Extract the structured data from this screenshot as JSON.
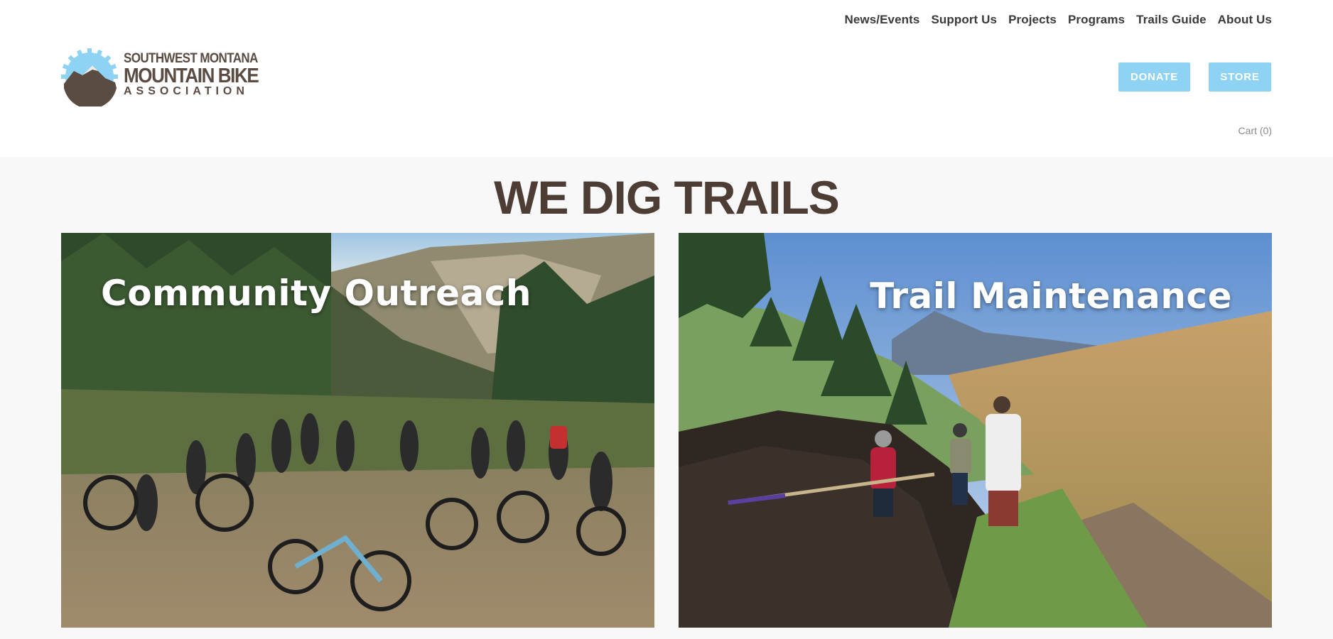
{
  "nav": {
    "items": [
      {
        "label": "News/Events"
      },
      {
        "label": "Support Us"
      },
      {
        "label": "Projects"
      },
      {
        "label": "Programs"
      },
      {
        "label": "Trails Guide"
      },
      {
        "label": "About Us"
      }
    ]
  },
  "logo": {
    "line1": "SOUTHWEST MONTANA",
    "line2": "MOUNTAIN BIKE",
    "line3": "ASSOCIATION"
  },
  "actions": {
    "donate_label": "DONATE",
    "store_label": "STORE",
    "cart_label": "Cart (0)"
  },
  "hero": {
    "headline": "WE DIG TRAILS"
  },
  "cards": [
    {
      "title": "Community Outreach"
    },
    {
      "title": "Trail Maintenance"
    }
  ],
  "colors": {
    "accent": "#8fd3f4",
    "headline": "#4d3d34",
    "logo_brown": "#5a4b43",
    "logo_sky": "#8fd3f4"
  }
}
